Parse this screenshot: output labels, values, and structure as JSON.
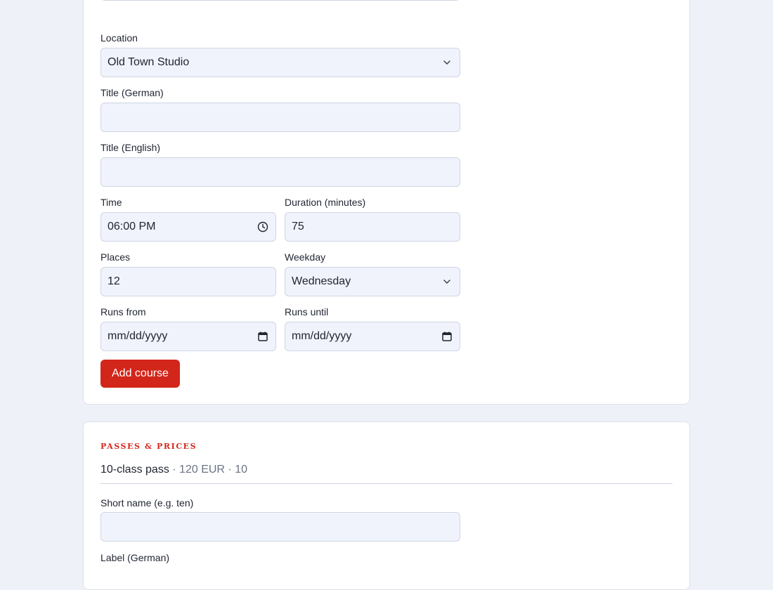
{
  "course_form": {
    "location": {
      "label": "Location",
      "value": "Old Town Studio"
    },
    "title_de": {
      "label": "Title (German)",
      "value": ""
    },
    "title_en": {
      "label": "Title (English)",
      "value": ""
    },
    "time": {
      "label": "Time",
      "value": "06:00 PM"
    },
    "duration": {
      "label": "Duration (minutes)",
      "value": "75"
    },
    "places": {
      "label": "Places",
      "value": "12"
    },
    "weekday": {
      "label": "Weekday",
      "value": "Wednesday"
    },
    "runs_from": {
      "label": "Runs from",
      "value": "mm/dd/yyyy"
    },
    "runs_until": {
      "label": "Runs until",
      "value": "mm/dd/yyyy"
    },
    "submit_label": "Add course"
  },
  "passes": {
    "heading": "PASSES & PRICES",
    "items": [
      {
        "name": "10-class pass",
        "separator": " · ",
        "price": "120 EUR",
        "count": "10"
      }
    ],
    "form": {
      "short_name": {
        "label": "Short name (e.g. ten)",
        "value": ""
      },
      "label_de": {
        "label": "Label (German)"
      }
    }
  },
  "icons": {
    "dropdown": "chevron-down-icon",
    "clock": "clock-icon",
    "calendar": "calendar-icon"
  },
  "colors": {
    "accent": "#d3261a",
    "input_bg": "#f0f3fc",
    "page_bg": "#eef1f7"
  }
}
